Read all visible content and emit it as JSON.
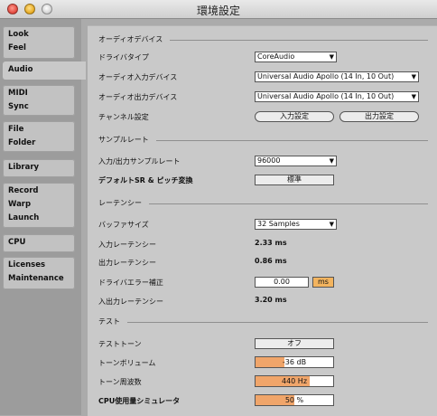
{
  "window": {
    "title": "環境設定"
  },
  "sidebar": {
    "tabs": [
      {
        "lines": [
          "Look",
          "Feel"
        ]
      },
      {
        "lines": [
          "Audio"
        ]
      },
      {
        "lines": [
          "MIDI",
          "Sync"
        ]
      },
      {
        "lines": [
          "File",
          "Folder"
        ]
      },
      {
        "lines": [
          "Library"
        ]
      },
      {
        "lines": [
          "Record",
          "Warp",
          "Launch"
        ]
      },
      {
        "lines": [
          "CPU"
        ]
      },
      {
        "lines": [
          "Licenses",
          "Maintenance"
        ]
      }
    ],
    "active_tab": "Audio"
  },
  "audio_device": {
    "section_title": "オーディオデバイス",
    "driver_type_label": "ドライバタイプ",
    "driver_type_value": "CoreAudio",
    "input_device_label": "オーディオ入力デバイス",
    "input_device_value": "Universal Audio Apollo (14 In, 10 Out)",
    "output_device_label": "オーディオ出力デバイス",
    "output_device_value": "Universal Audio Apollo (14 In, 10 Out)",
    "channel_config_label": "チャンネル設定",
    "input_config_button": "入力設定",
    "output_config_button": "出力設定"
  },
  "sample_rate": {
    "section_title": "サンプルレート",
    "io_rate_label": "入力/出力サンプルレート",
    "io_rate_value": "96000",
    "default_sr_label": "デフォルトSR & ピッチ変換",
    "default_sr_value": "標準"
  },
  "latency": {
    "section_title": "レーテンシー",
    "buffer_label": "バッファサイズ",
    "buffer_value": "32 Samples",
    "input_latency_label": "入力レーテンシー",
    "input_latency_value": "2.33 ms",
    "output_latency_label": "出力レーテンシー",
    "output_latency_value": "0.86 ms",
    "driver_error_label": "ドライバエラー補正",
    "driver_error_value": "0.00",
    "driver_error_unit": "ms",
    "io_latency_label": "入出力レーテンシー",
    "io_latency_value": "3.20 ms"
  },
  "test": {
    "section_title": "テスト",
    "tone_label": "テストトーン",
    "tone_value": "オフ",
    "volume_label": "トーンボリューム",
    "volume_value": "-36 dB",
    "volume_fill_fraction": 0.37,
    "freq_label": "トーン周波数",
    "freq_value": "440 Hz",
    "freq_fill_fraction": 0.7,
    "cpu_sim_label": "CPU使用量シミュレータ",
    "cpu_sim_value": "50 %",
    "cpu_sim_fill_fraction": 0.5
  },
  "colors": {
    "accent_orange": "#f0a56a",
    "unit_orange": "#f3b45f",
    "panel_bg": "#c9c9c9"
  }
}
